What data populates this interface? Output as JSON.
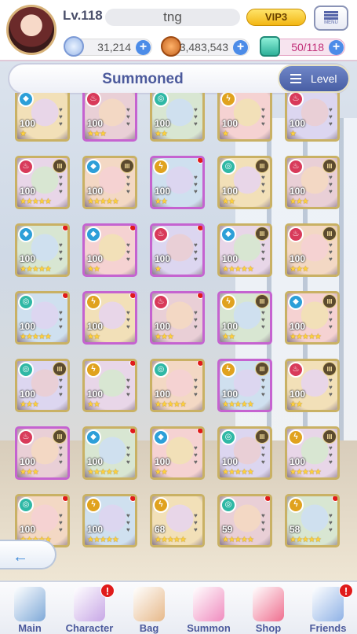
{
  "header": {
    "level": "Lv.118",
    "player_name": "tng",
    "vip": "VIP3",
    "menu_label": "MENU",
    "stars_value": "31,214",
    "coins_value": "3,483,543",
    "stamina_value": "50/118",
    "plus": "+"
  },
  "titlebar": {
    "title": "Summoned",
    "sort_label": "Level"
  },
  "cards": [
    {
      "level": "100",
      "stars": "★",
      "element": "water",
      "rank": "",
      "heart": true,
      "dot": false,
      "pink": false
    },
    {
      "level": "100",
      "stars": "★★★",
      "element": "fire",
      "rank": "",
      "heart": true,
      "dot": false,
      "pink": true
    },
    {
      "level": "100",
      "stars": "★★",
      "element": "wind",
      "rank": "",
      "heart": true,
      "dot": false,
      "pink": false
    },
    {
      "level": "100",
      "stars": "★",
      "element": "light",
      "rank": "",
      "heart": true,
      "dot": false,
      "pink": false
    },
    {
      "level": "100",
      "stars": "★",
      "element": "fire",
      "rank": "",
      "heart": true,
      "dot": false,
      "pink": false
    },
    {
      "level": "100",
      "stars": "★★★★★",
      "element": "fire",
      "rank": "III",
      "heart": true,
      "dot": false,
      "pink": false
    },
    {
      "level": "100",
      "stars": "★★★★★",
      "element": "water",
      "rank": "III",
      "heart": true,
      "dot": false,
      "pink": false
    },
    {
      "level": "100",
      "stars": "★★",
      "element": "light",
      "rank": "",
      "heart": true,
      "dot": true,
      "pink": true
    },
    {
      "level": "100",
      "stars": "★★",
      "element": "wind",
      "rank": "III",
      "heart": true,
      "dot": false,
      "pink": false
    },
    {
      "level": "100",
      "stars": "★★★",
      "element": "fire",
      "rank": "III",
      "heart": true,
      "dot": false,
      "pink": false
    },
    {
      "level": "100",
      "stars": "★★★★★",
      "element": "water",
      "rank": "",
      "heart": true,
      "dot": true,
      "pink": false
    },
    {
      "level": "100",
      "stars": "★★",
      "element": "water",
      "rank": "",
      "heart": true,
      "dot": true,
      "pink": true
    },
    {
      "level": "100",
      "stars": "★",
      "element": "fire",
      "rank": "",
      "heart": true,
      "dot": true,
      "pink": true
    },
    {
      "level": "100",
      "stars": "★★★★★",
      "element": "water",
      "rank": "III",
      "heart": true,
      "dot": false,
      "pink": false
    },
    {
      "level": "100",
      "stars": "★★★",
      "element": "fire",
      "rank": "III",
      "heart": true,
      "dot": false,
      "pink": false
    },
    {
      "level": "100",
      "stars": "★★★★★",
      "element": "wind",
      "rank": "",
      "heart": true,
      "dot": true,
      "pink": false
    },
    {
      "level": "100",
      "stars": "★★",
      "element": "light",
      "rank": "",
      "heart": true,
      "dot": true,
      "pink": true
    },
    {
      "level": "100",
      "stars": "★★★",
      "element": "fire",
      "rank": "",
      "heart": true,
      "dot": true,
      "pink": true
    },
    {
      "level": "100",
      "stars": "★★",
      "element": "light",
      "rank": "III",
      "heart": true,
      "dot": false,
      "pink": true
    },
    {
      "level": "100",
      "stars": "★★★★★",
      "element": "water",
      "rank": "III",
      "heart": true,
      "dot": false,
      "pink": false
    },
    {
      "level": "100",
      "stars": "★★★",
      "element": "wind",
      "rank": "III",
      "heart": true,
      "dot": false,
      "pink": false
    },
    {
      "level": "100",
      "stars": "★★",
      "element": "light",
      "rank": "",
      "heart": true,
      "dot": true,
      "pink": false
    },
    {
      "level": "100",
      "stars": "★★★★★",
      "element": "wind",
      "rank": "",
      "heart": true,
      "dot": true,
      "pink": false
    },
    {
      "level": "100",
      "stars": "★★★★★",
      "element": "light",
      "rank": "III",
      "heart": true,
      "dot": false,
      "pink": true
    },
    {
      "level": "100",
      "stars": "★★",
      "element": "fire",
      "rank": "III",
      "heart": true,
      "dot": false,
      "pink": false
    },
    {
      "level": "100",
      "stars": "★★★",
      "element": "fire",
      "rank": "III",
      "heart": true,
      "dot": false,
      "pink": true
    },
    {
      "level": "100",
      "stars": "★★★★★",
      "element": "water",
      "rank": "",
      "heart": true,
      "dot": true,
      "pink": false
    },
    {
      "level": "100",
      "stars": "★★",
      "element": "water",
      "rank": "",
      "heart": true,
      "dot": true,
      "pink": false
    },
    {
      "level": "100",
      "stars": "★★★★★",
      "element": "wind",
      "rank": "III",
      "heart": true,
      "dot": false,
      "pink": false
    },
    {
      "level": "100",
      "stars": "★★★★★",
      "element": "light",
      "rank": "III",
      "heart": true,
      "dot": false,
      "pink": false
    },
    {
      "level": "100",
      "stars": "★★★★★",
      "element": "wind",
      "rank": "",
      "heart": true,
      "dot": true,
      "pink": false
    },
    {
      "level": "100",
      "stars": "★★★★★",
      "element": "light",
      "rank": "",
      "heart": true,
      "dot": true,
      "pink": false
    },
    {
      "level": "68",
      "stars": "★★★★★",
      "element": "light",
      "rank": "",
      "heart": true,
      "dot": false,
      "pink": false
    },
    {
      "level": "59",
      "stars": "★★★★★",
      "element": "wind",
      "rank": "",
      "heart": true,
      "dot": true,
      "pink": false
    },
    {
      "level": "58",
      "stars": "★★★★★",
      "element": "light",
      "rank": "",
      "heart": true,
      "dot": true,
      "pink": false
    }
  ],
  "back_arrow": "←",
  "nav": [
    {
      "label": "Main",
      "icon": "castle-icon",
      "badge": ""
    },
    {
      "label": "Character",
      "icon": "character-icon",
      "badge": "!"
    },
    {
      "label": "Bag",
      "icon": "bag-icon",
      "badge": ""
    },
    {
      "label": "Summon",
      "icon": "summon-phone-icon",
      "badge": ""
    },
    {
      "label": "Shop",
      "icon": "cart-icon",
      "badge": ""
    },
    {
      "label": "Friends",
      "icon": "friends-icon",
      "badge": "!"
    }
  ],
  "colors": {
    "accent": "#4c5a9c",
    "notify": "#e01b1b",
    "frame_gold": "#c9b164",
    "frame_pink": "#c563d0"
  }
}
